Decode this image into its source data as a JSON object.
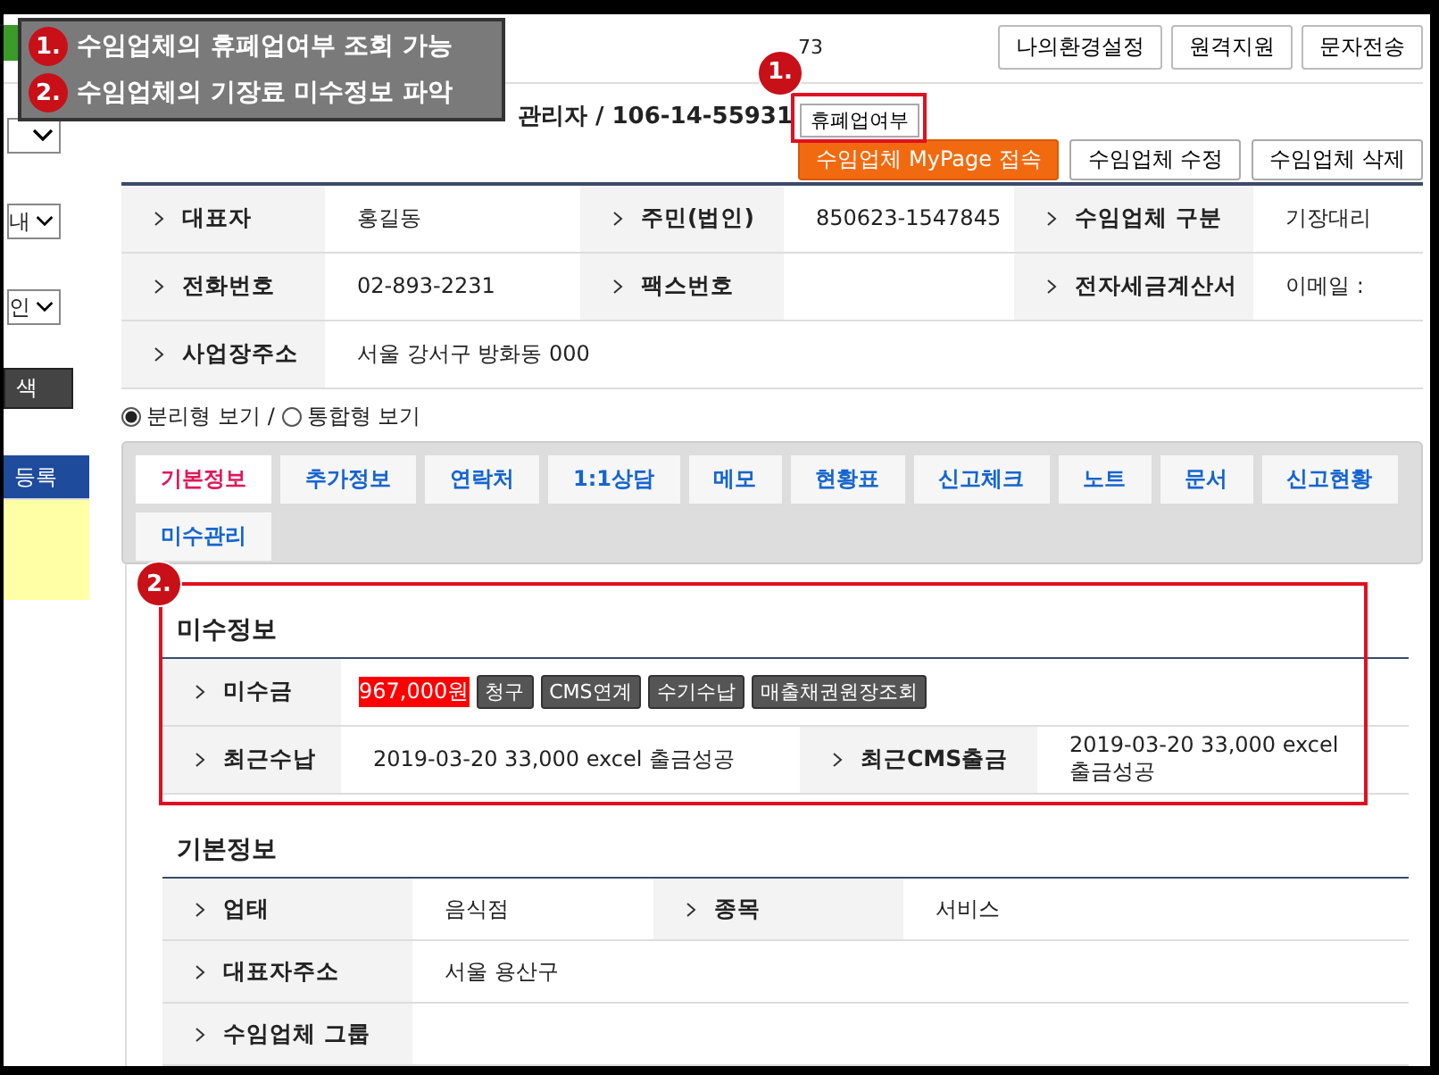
{
  "annotations": [
    {
      "number": "1.",
      "text": "수임업체의 휴폐업여부 조회 가능"
    },
    {
      "number": "2.",
      "text": "수임업체의 기장료 미수정보 파악"
    }
  ],
  "status_marker": {
    "number": "1."
  },
  "receivables_marker": {
    "number": "2."
  },
  "header": {
    "partial_text": "73",
    "buttons": [
      "나의환경설정",
      "원격지원",
      "문자전송"
    ]
  },
  "sidebar": {
    "selects": [
      "내",
      "인"
    ],
    "search_button": "색",
    "register_button": "등록"
  },
  "client": {
    "title": "관리자 / 106-14-55931",
    "status_button": "휴폐업여부",
    "actions": [
      {
        "label": "수임업체 MyPage 접속",
        "kind": "primary"
      },
      {
        "label": "수임업체 수정",
        "kind": "normal"
      },
      {
        "label": "수임업체 삭제",
        "kind": "normal"
      }
    ]
  },
  "info_rows": [
    [
      {
        "label": "대표자",
        "value": "홍길동"
      },
      {
        "label": "주민(법인)",
        "value": "850623-1547845"
      },
      {
        "label": "수임업체 구분",
        "value": "기장대리"
      }
    ],
    [
      {
        "label": "전화번호",
        "value": "02-893-2231"
      },
      {
        "label": "팩스번호"
      },
      {
        "label": "전자세금계산서",
        "value": "이메일 :"
      }
    ],
    [
      {
        "label": "사업장주소",
        "value": "서울 강서구 방화동 000"
      }
    ]
  ],
  "view_modes": [
    {
      "label": "분리형 보기",
      "selected": true
    },
    {
      "label": "통합형 보기",
      "selected": false
    }
  ],
  "view_separator": "/",
  "tabs": [
    {
      "label": "기본정보",
      "selected": true
    },
    {
      "label": "추가정보",
      "selected": false
    },
    {
      "label": "연락처",
      "selected": false
    },
    {
      "label": "1:1상담",
      "selected": false
    },
    {
      "label": "메모",
      "selected": false
    },
    {
      "label": "현황표",
      "selected": false
    },
    {
      "label": "신고체크",
      "selected": false
    },
    {
      "label": "노트",
      "selected": false
    },
    {
      "label": "문서",
      "selected": false
    },
    {
      "label": "신고현황",
      "selected": false
    },
    {
      "label": "미수관리",
      "selected": false
    }
  ],
  "receivables": {
    "title": "미수정보",
    "amount_label": "미수금",
    "amount": "967,000원",
    "actions": [
      "청구",
      "CMS연계",
      "수기수납",
      "매출채권원장조회"
    ],
    "rows": [
      {
        "label": "최근수납",
        "value": "2019-03-20 33,000 excel 출금성공"
      },
      {
        "label": "최근CMS출금",
        "value": "2019-03-20 33,000 excel 출금성공"
      }
    ]
  },
  "basic_info": {
    "title": "기본정보",
    "rows": [
      [
        {
          "label": "업태",
          "value": "음식점"
        },
        {
          "label": "종목",
          "value": "서비스"
        }
      ],
      [
        {
          "label": "대표자주소",
          "value": "서울 용산구"
        }
      ],
      [
        {
          "label": "수임업체 그룹"
        }
      ]
    ]
  }
}
